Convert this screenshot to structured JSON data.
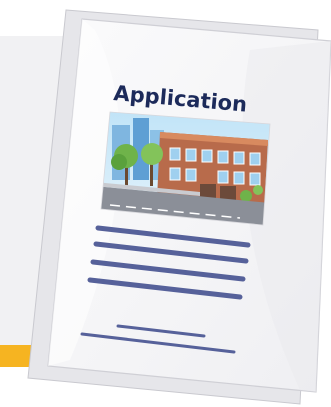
{
  "document": {
    "title": "Application"
  },
  "colors": {
    "accent": "#f6b421",
    "title": "#1c2a5a",
    "lines": "#56619a",
    "page": "#f7f7f9",
    "background_panel": "#f1f1f3"
  },
  "icons": {
    "illustration": "building-street-icon"
  }
}
